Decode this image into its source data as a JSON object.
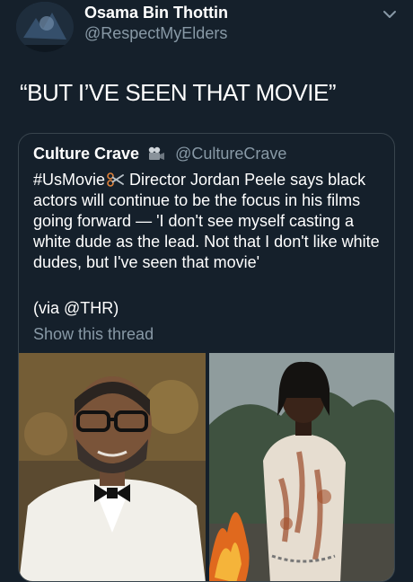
{
  "tweet": {
    "author": {
      "name": "Osama Bin Thottin",
      "handle": "@RespectMyElders"
    },
    "text": "“BUT I’VE SEEN THAT MOVIE”",
    "menu_icon": "chevron-down-icon"
  },
  "quoted_tweet": {
    "author": {
      "name": "Culture Crave",
      "handle": "@CultureCrave",
      "badge_icon": "movie-camera-icon"
    },
    "body_hashtag": "#UsMovie",
    "body_icon": "scissors-icon",
    "body_text": " Director Jordan Peele says black actors will continue to be the focus in his films going forward — 'I don't see myself casting a white dude as the lead. Not that I don't like white dudes, but I've seen that movie'",
    "via_text": "(via @THR)",
    "show_thread": "Show this thread",
    "images": [
      {
        "icon": "photo-man-in-tuxedo"
      },
      {
        "icon": "photo-woman-in-bloody-dress"
      }
    ]
  },
  "colors": {
    "background": "#15202b",
    "text": "#ffffff",
    "secondary_text": "#8899a6",
    "border": "#38444d"
  }
}
